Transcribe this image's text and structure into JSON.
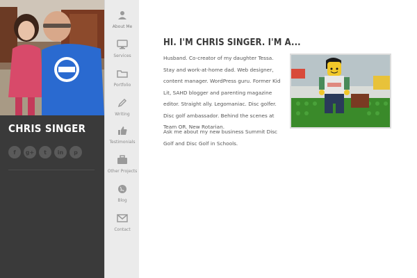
{
  "profile": {
    "name": "Chris Singer",
    "photo_icon": "family-photo"
  },
  "socials": [
    {
      "icon": "facebook-icon",
      "glyph": "f"
    },
    {
      "icon": "google-plus-icon",
      "glyph": "g+"
    },
    {
      "icon": "twitter-icon",
      "glyph": "t"
    },
    {
      "icon": "linkedin-icon",
      "glyph": "in"
    },
    {
      "icon": "pinterest-icon",
      "glyph": "p"
    }
  ],
  "nav": {
    "items": [
      {
        "label": "About Me",
        "icon": "user-icon"
      },
      {
        "label": "Services",
        "icon": "monitor-icon"
      },
      {
        "label": "Portfolio",
        "icon": "folder-icon"
      },
      {
        "label": "Writing",
        "icon": "pencil-icon"
      },
      {
        "label": "Testimonials",
        "icon": "thumbs-up-icon"
      },
      {
        "label": "Other Projects",
        "icon": "briefcase-icon"
      },
      {
        "label": "Blog",
        "icon": "globe-icon"
      },
      {
        "label": "Contact",
        "icon": "envelope-icon"
      }
    ],
    "active": "About Me"
  },
  "main": {
    "heading": "Hi. I'm Chris Singer. I'm a...",
    "bio": "Husband. Co-creator of my daughter Tessa. Stay and work-at-home dad. Web designer, content manager. WordPress guru. Former Kid Lit, SAHD blogger and parenting magazine editor. Straight ally. Legomaniac. Disc golfer. Disc golf ambassador. Behind the scenes at Team OR. New Rotarian.",
    "bio2": "Ask me about my new business Summit Disc Golf and Disc Golf in Schools.",
    "photo_icon": "lego-minifigure-photo"
  },
  "colors": {
    "sidebar": "#3a3a3a",
    "nav": "#ebebeb",
    "heading": "#3a3a3a",
    "body_text": "#555555"
  }
}
